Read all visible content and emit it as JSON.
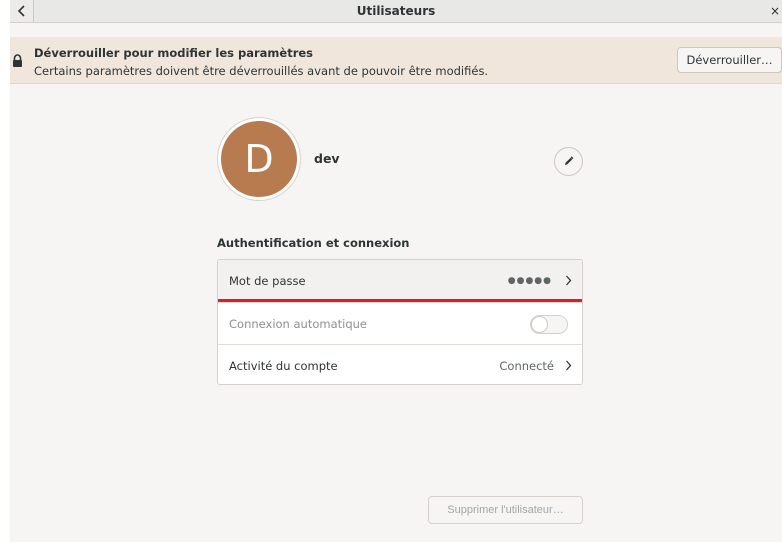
{
  "window": {
    "title": "Utilisateurs",
    "close_glyph": "×"
  },
  "infobar": {
    "title": "Déverrouiller pour modifier les paramètres",
    "description": "Certains paramètres doivent être déverrouillés avant de pouvoir être modifiés.",
    "unlock_label": "Déverrouiller…"
  },
  "user": {
    "initial": "D",
    "name": "dev",
    "avatar_color": "#b87a4f"
  },
  "auth_section": {
    "title": "Authentification et connexion",
    "rows": [
      {
        "label": "Mot de passe",
        "value": "●●●●●"
      },
      {
        "label": "Connexion automatique",
        "toggle": false
      },
      {
        "label": "Activité du compte",
        "value": "Connecté"
      }
    ]
  },
  "actions": {
    "delete_label": "Supprimer l'utilisateur…"
  },
  "colors": {
    "accent_focus": "#e01b24",
    "infobar_bg": "#f1e6dc"
  }
}
